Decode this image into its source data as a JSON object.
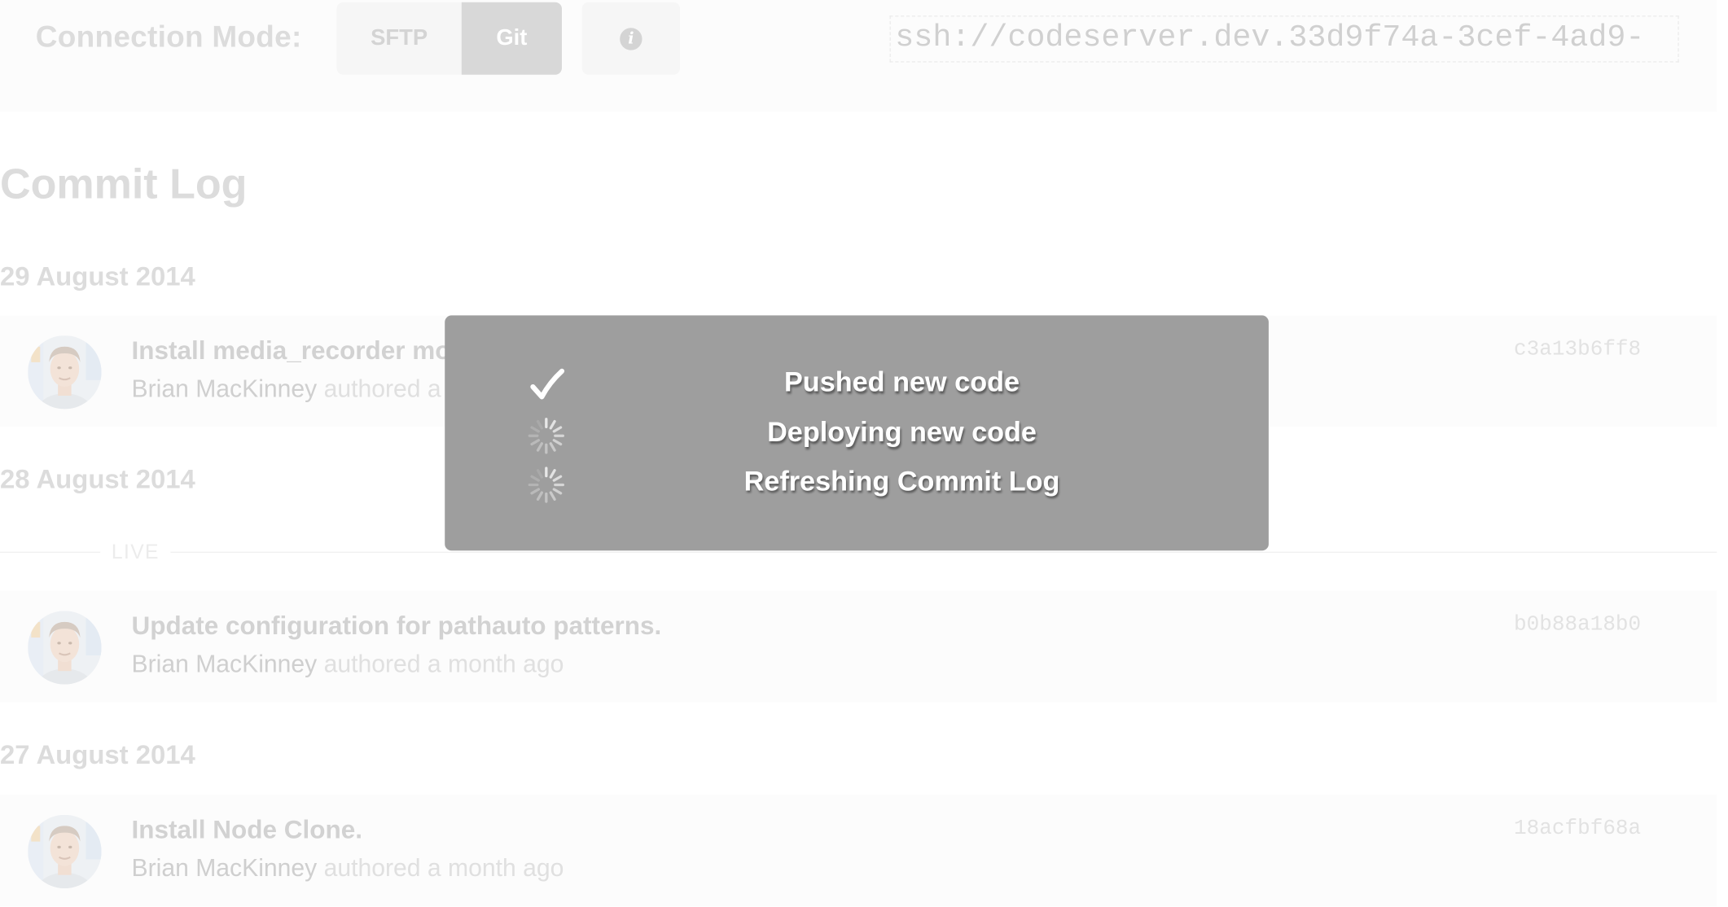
{
  "header": {
    "connection_mode_label": "Connection Mode:",
    "modes": [
      "SFTP",
      "Git"
    ],
    "active_mode": "Git",
    "info_icon": "info-icon",
    "ssh_url": "ssh://codeserver.dev.33d9f74a-3cef-4ad9-"
  },
  "commit_log": {
    "title": "Commit Log",
    "live_label": "LIVE",
    "groups": [
      {
        "date": "29 August 2014",
        "commits": [
          {
            "message": "Install media_recorder module and required libraries",
            "author": "Brian MacKinney",
            "authored": "authored a month ago",
            "hash": "c3a13b6ff8"
          }
        ]
      },
      {
        "date": "28 August 2014",
        "commits": [
          {
            "message": "Update configuration for pathauto patterns.",
            "author": "Brian MacKinney",
            "authored": "authored a month ago",
            "hash": "b0b88a18b0"
          }
        ]
      },
      {
        "date": "27 August 2014",
        "commits": [
          {
            "message": "Install Node Clone.",
            "author": "Brian MacKinney",
            "authored": "authored a month ago",
            "hash": "18acfbf68a"
          }
        ]
      }
    ]
  },
  "modal": {
    "steps": [
      {
        "label": "Pushed new code",
        "status": "done",
        "icon": "checkmark-icon"
      },
      {
        "label": "Deploying new code",
        "status": "in-progress",
        "icon": "spinner-icon"
      },
      {
        "label": "Refreshing Commit Log",
        "status": "in-progress",
        "icon": "spinner-icon"
      }
    ]
  },
  "colors": {
    "modal_background": "#9e9e9e",
    "faded_text": "#dcdcdc",
    "active_segment": "#d8d8d8"
  }
}
